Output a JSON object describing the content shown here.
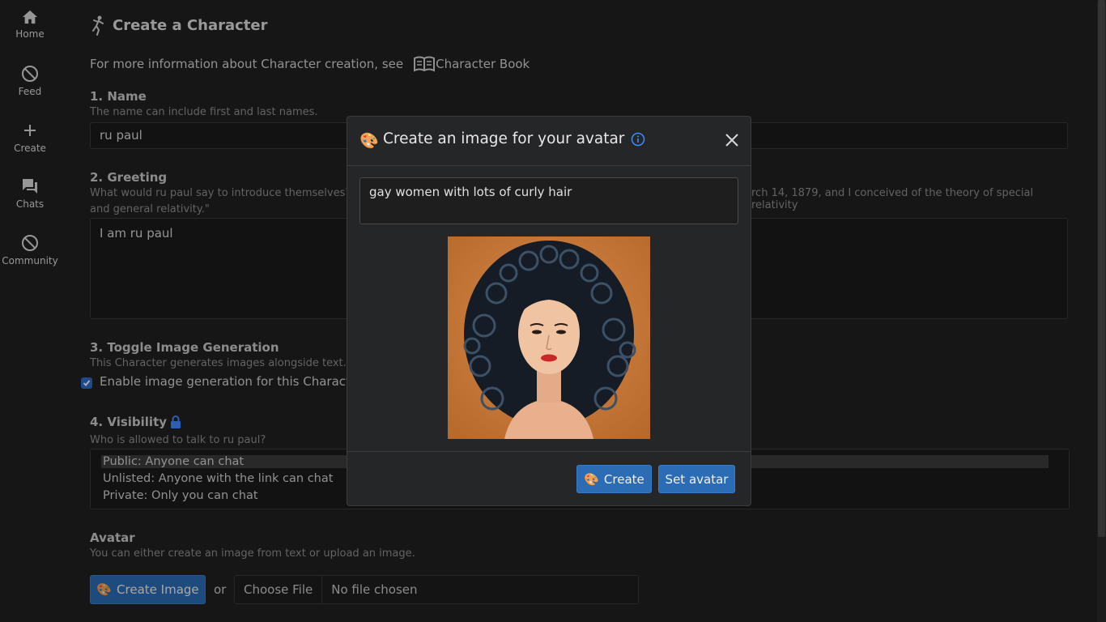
{
  "sidebar": {
    "items": [
      {
        "label": "Home",
        "icon": "home-icon"
      },
      {
        "label": "Feed",
        "icon": "blocked-icon"
      },
      {
        "label": "Create",
        "icon": "plus-icon"
      },
      {
        "label": "Chats",
        "icon": "chat-icon"
      },
      {
        "label": "Community",
        "icon": "blocked-icon"
      }
    ]
  },
  "page": {
    "title": "Create a Character",
    "info_text": "For more information about Character creation, see",
    "book_link": "Character Book"
  },
  "name_section": {
    "title": "1. Name",
    "help": "The name can include first and last names.",
    "value": "ru paul"
  },
  "greeting_section": {
    "title": "2. Greeting",
    "help_left": "What would ru paul say to introduce themselves? Fo",
    "help_right": "rch 14, 1879, and I conceived of the theory of special relativity",
    "help_line2": "and general relativity.\"",
    "value": "I am ru paul"
  },
  "image_gen_section": {
    "title": "3. Toggle Image Generation",
    "help": "This Character generates images alongside text.",
    "checkbox_label": "Enable image generation for this Character.",
    "checked": true
  },
  "visibility_section": {
    "title": "4. Visibility",
    "help": "Who is allowed to talk to ru paul?",
    "options": [
      "Public: Anyone can chat",
      "Unlisted: Anyone with the link can chat",
      "Private: Only you can chat"
    ],
    "selected": 0
  },
  "avatar_section": {
    "title": "Avatar",
    "help": "You can either create an image from text or upload an image.",
    "create_button": "Create Image",
    "or_text": "or",
    "choose_file": "Choose File",
    "no_file": "No file chosen"
  },
  "modal": {
    "title": "Create an image for your avatar",
    "prompt": "gay women  with  lots of  curly hair",
    "create_button": "Create",
    "set_avatar_button": "Set avatar"
  },
  "colors": {
    "accent": "#2b6cb5",
    "background": "#202020",
    "modal_bg": "#252628",
    "info_icon": "#3d8bff"
  }
}
